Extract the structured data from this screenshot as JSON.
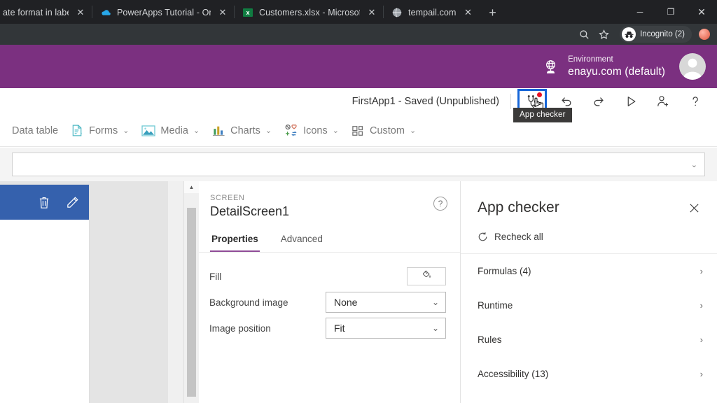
{
  "browser": {
    "tabs": [
      {
        "title": "ate format in labels and",
        "favicon": "none-icon",
        "close_label": "✕"
      },
      {
        "title": "PowerApps Tutorial - OneDrive",
        "favicon": "onedrive-icon",
        "close_label": "✕"
      },
      {
        "title": "Customers.xlsx - Microsoft Excel",
        "favicon": "excel-icon",
        "close_label": "✕"
      },
      {
        "title": "tempail.com",
        "favicon": "globe-icon",
        "close_label": "✕"
      }
    ],
    "new_tab_label": "+",
    "window_controls": {
      "minimize": "─",
      "maximize": "❐",
      "close": "✕"
    },
    "toolbar": {
      "search_icon": "search-icon",
      "bookmark_icon": "star-icon",
      "incognito_label": "Incognito (2)"
    }
  },
  "environment": {
    "label": "Environment",
    "name": "enayu.com (default)",
    "globe_icon": "globe-stand-icon",
    "avatar": "user-avatar"
  },
  "command_bar": {
    "app_title": "FirstApp1 - Saved (Unpublished)",
    "app_checker_icon": "stethoscope-icon",
    "app_checker_badge": "error-dot",
    "undo_icon": "undo-arrow-icon",
    "redo_icon": "redo-arrow-icon",
    "preview_icon": "play-triangle-icon",
    "share_icon": "person-add-icon",
    "help_icon": "question-mark-icon",
    "tooltip": "App checker"
  },
  "ribbon": {
    "items": [
      {
        "label": "Data table",
        "icon": "none",
        "caret": ""
      },
      {
        "label": "Forms",
        "icon": "form-icon",
        "caret": "⌄"
      },
      {
        "label": "Media",
        "icon": "image-icon",
        "caret": "⌄"
      },
      {
        "label": "Charts",
        "icon": "bar-chart-icon",
        "caret": "⌄"
      },
      {
        "label": "Icons",
        "icon": "shapes-icon",
        "caret": "⌄"
      },
      {
        "label": "Custom",
        "icon": "grid-blocks-icon",
        "caret": "⌄"
      }
    ]
  },
  "formula_bar": {
    "value": "",
    "placeholder": "",
    "expand_caret": "⌄"
  },
  "canvas": {
    "screen_toolbar": {
      "delete_icon": "trash-icon",
      "edit_icon": "pencil-icon"
    },
    "scrollbar": {
      "up_arrow": "▲"
    }
  },
  "properties": {
    "kicker": "SCREEN",
    "name": "DetailScreen1",
    "help_icon": "question-circle-icon",
    "tabs": [
      {
        "label": "Properties",
        "active": true
      },
      {
        "label": "Advanced",
        "active": false
      }
    ],
    "rows": [
      {
        "label": "Fill",
        "control": "color",
        "value": "",
        "icon": "paint-bucket-icon"
      },
      {
        "label": "Background image",
        "control": "select",
        "value": "None",
        "caret": "⌄"
      },
      {
        "label": "Image position",
        "control": "select",
        "value": "Fit",
        "caret": "⌄"
      }
    ]
  },
  "app_checker": {
    "title": "App checker",
    "close_icon": "close-icon",
    "recheck": {
      "label": "Recheck all",
      "icon": "refresh-icon"
    },
    "items": [
      {
        "label": "Formulas (4)",
        "caret": "›"
      },
      {
        "label": "Runtime",
        "caret": "›"
      },
      {
        "label": "Rules",
        "caret": "›"
      },
      {
        "label": "Accessibility (13)",
        "caret": "›"
      }
    ]
  },
  "colors": {
    "brand_purple": "#7b3080",
    "accent_purple": "#8f4b97",
    "screen_header_blue": "#3561ad",
    "focus_blue": "#1565d8",
    "error_red": "#e81123"
  }
}
